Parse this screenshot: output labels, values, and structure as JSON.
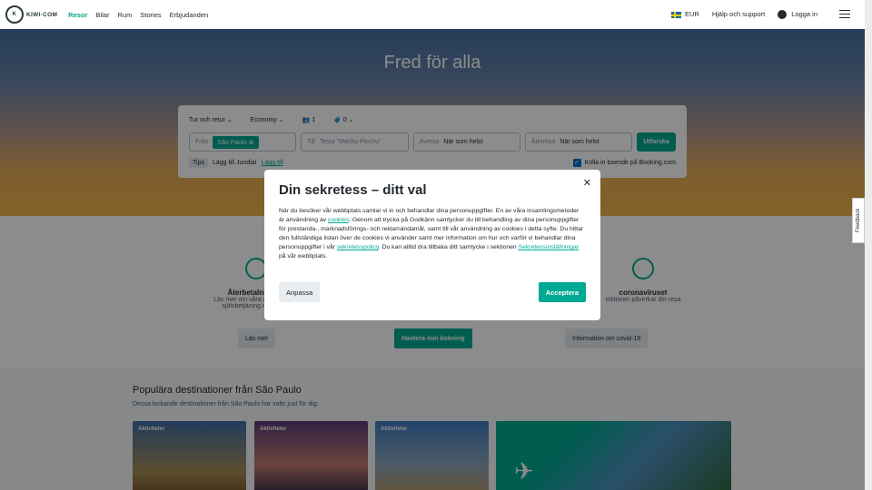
{
  "header": {
    "logo": "KIWI·COM",
    "nav": [
      "Resor",
      "Bilar",
      "Rum",
      "Stories",
      "Erbjudanden"
    ],
    "currency": "EUR",
    "help": "Hjälp och support",
    "login": "Logga in"
  },
  "hero": {
    "title": "Fred för alla"
  },
  "search": {
    "trip_type": "Tur och retur",
    "cabin": "Economy",
    "passengers": "1",
    "bags": "0",
    "from_label": "Från",
    "from_value": "São Paulo",
    "to_label": "Till",
    "to_placeholder": "Testa \"Machu Picchu\"",
    "depart_label": "Avresa",
    "depart_value": "När som helst",
    "return_label": "Återresa",
    "return_value": "När som helst",
    "button": "Utforska",
    "tips": "Tips",
    "tip_text": "Lägg till Jundiaí",
    "tip_link": "Lägg till",
    "booking": "Kolla in boende på Booking.com"
  },
  "features": {
    "f1_title": "Återbetalning oc",
    "f1_text": "Läs mer om våra många återb",
    "f1_text2": "självbetjäning och omed",
    "f1_btn": "Läs mer",
    "f2_btn": "Hantera min bokning",
    "f3_title": "coronaviruset",
    "f3_text": "triktioner påverkar din resa",
    "f3_btn": "Information om covid-19"
  },
  "popular": {
    "title": "Populära destinationer från São Paulo",
    "subtitle": "Dessa lockande destinationer från São Paulo har valts just för dig.",
    "tag": "Aktiviteter"
  },
  "modal": {
    "title": "Din sekretess – ditt val",
    "p1": "När du besöker vår webbplats samlar vi in och behandlar dina personuppgifter. En av våra insamlingsmetoder är användning av ",
    "cookies": "cookies",
    "p2": ". Genom att trycka på Godkänn samtycker du till behandling av dina personuppgifter för prestanda-, marknadsförings- och reklamändamål, samt till vår användning av cookies i detta syfte. Du hittar den fullständiga listan över de cookies vi använder samt mer information om hur och varför vi behandlar dina personuppgifter i vår ",
    "policy": "sekretesspolicy",
    "p3": ". Du kan alltid dra tillbaka ditt samtycke i sektionen ",
    "settings": "Sekretessinställningar",
    "p4": " på vår webbplats.",
    "customize": "Anpassa",
    "accept": "Acceptera"
  },
  "feedback": "Feedback"
}
